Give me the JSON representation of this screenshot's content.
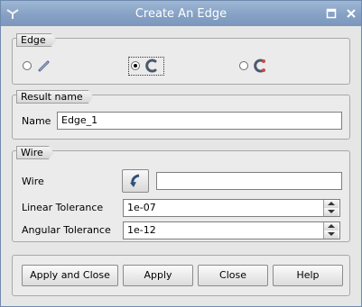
{
  "window": {
    "title": "Create An Edge"
  },
  "edge_group": {
    "label": "Edge",
    "selected_option": 2
  },
  "result_group": {
    "label": "Result name",
    "name_label": "Name",
    "name_value": "Edge_1"
  },
  "wire_group": {
    "label": "Wire",
    "wire_label": "Wire",
    "wire_value": "",
    "linear_tolerance_label": "Linear Tolerance",
    "linear_tolerance_value": "1e-07",
    "angular_tolerance_label": "Angular Tolerance",
    "angular_tolerance_value": "1e-12"
  },
  "buttons": {
    "apply_close": "Apply and Close",
    "apply": "Apply",
    "close": "Close",
    "help": "Help"
  },
  "colors": {
    "titlebar": "#86a1c4",
    "accent": "#c84b4b"
  }
}
